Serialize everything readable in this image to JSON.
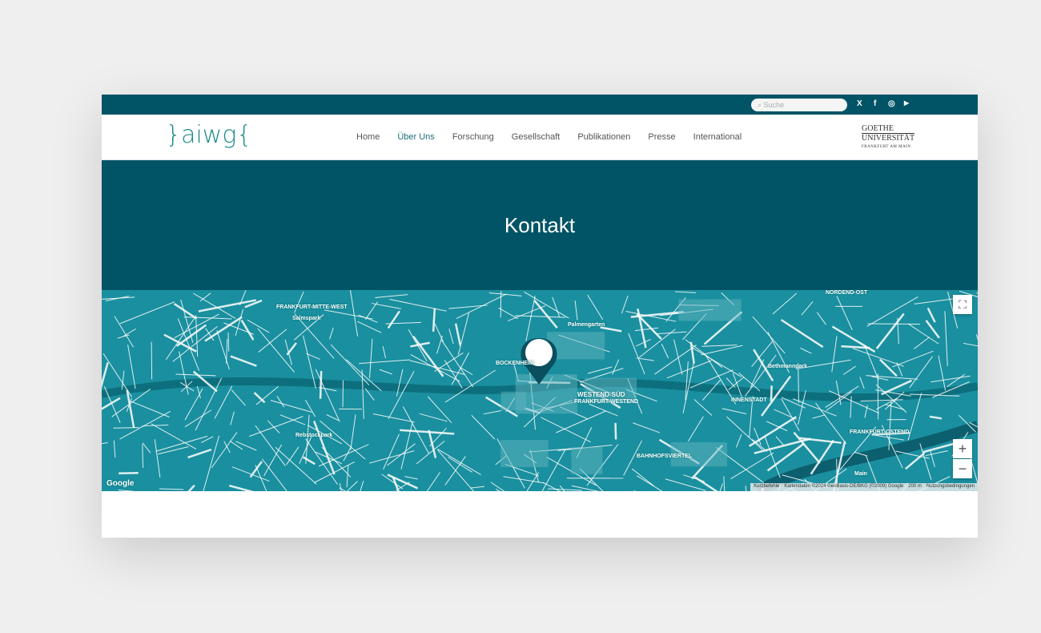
{
  "topbar": {
    "search_placeholder": "Suche",
    "social": [
      "X",
      "f",
      "◎",
      "▶"
    ]
  },
  "header": {
    "logo": "}aiwg{",
    "nav": [
      "Home",
      "Über Uns",
      "Forschung",
      "Gesellschaft",
      "Publikationen",
      "Presse",
      "International"
    ],
    "active": "Über Uns",
    "partner": {
      "line1": "GOETHE",
      "line2": "UNIVERSITÄT",
      "line3": "FRANKFURT AM MAIN"
    }
  },
  "hero": {
    "title": "Kontakt"
  },
  "map": {
    "labels": [
      "FRANKFURT-MITTE-WEST",
      "Salmspark",
      "BOCKENHEIM",
      "Palmengarten",
      "WESTEND-SÜD",
      "FRANKFURT-WESTEND",
      "Rebstockpark",
      "NORDEND-OST",
      "Bethmannpark",
      "INNENSTADT",
      "BAHNHOFSVIERTEL",
      "FRANKFURT-OSTEND",
      "Main",
      "Google"
    ],
    "attribution": [
      "Kurzbefehle",
      "Kartendaten ©2024 GeoBasis-DE/BKG (©2009) Google",
      "200 m",
      "Nutzungsbedingungen"
    ],
    "zoom_in": "+",
    "zoom_out": "−",
    "fullscreen": "⛶"
  },
  "colors": {
    "brand": "#005466",
    "map": "#1a8f9f",
    "logo": "#1d8a8a"
  }
}
